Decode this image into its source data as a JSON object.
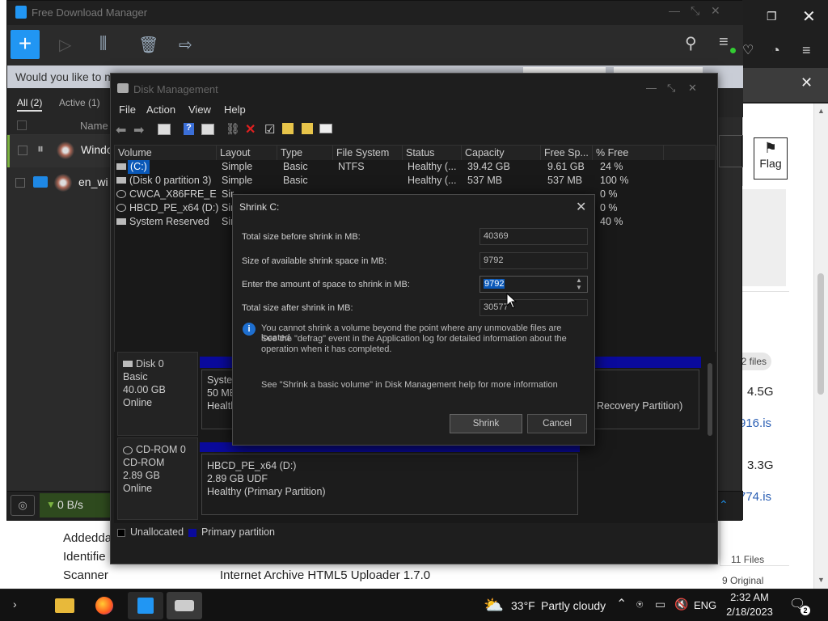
{
  "fdm": {
    "title": "Free Download Manager",
    "notice": "Would you like to ma",
    "notice_tail": "?",
    "tabs": [
      {
        "label": "All (2)"
      },
      {
        "label": "Active (1)"
      }
    ],
    "column_name": "Name",
    "rows": [
      {
        "name": "Windo"
      },
      {
        "name": "en_wi"
      }
    ],
    "speed": "0 B/s"
  },
  "browser": {
    "flag_label": "Flag",
    "files_badge": "2 files",
    "sizes": [
      "4.5G",
      "3.3G"
    ],
    "links": [
      "916.is",
      "774.is"
    ],
    "meta_labels": [
      "Addedda",
      "Identifie",
      "Scanner"
    ],
    "scanner_value": "Internet Archive HTML5 Uploader 1.7.0",
    "files_count": "11 Files",
    "original_count": "9 Original"
  },
  "disk_mgmt": {
    "title": "Disk Management",
    "menu": [
      "File",
      "Action",
      "View",
      "Help"
    ],
    "columns": [
      "Volume",
      "Layout",
      "Type",
      "File System",
      "Status",
      "Capacity",
      "Free Sp...",
      "% Free"
    ],
    "volumes": [
      {
        "volume": "(C:)",
        "layout": "Simple",
        "type": "Basic",
        "fs": "NTFS",
        "status": "Healthy (...",
        "capacity": "39.42 GB",
        "free": "9.61 GB",
        "pct": "24 %"
      },
      {
        "volume": "(Disk 0 partition 3)",
        "layout": "Simple",
        "type": "Basic",
        "fs": "",
        "status": "Healthy (...",
        "capacity": "537 MB",
        "free": "537 MB",
        "pct": "100 %"
      },
      {
        "volume": "CWCA_X86FRE_E...",
        "layout": "Sir",
        "type": "",
        "fs": "",
        "status": "",
        "capacity": "",
        "free": "",
        "pct": "0 %"
      },
      {
        "volume": "HBCD_PE_x64 (D:)",
        "layout": "Sir",
        "type": "",
        "fs": "",
        "status": "",
        "capacity": "",
        "free": "",
        "pct": "0 %"
      },
      {
        "volume": "System Reserved",
        "layout": "Sir",
        "type": "",
        "fs": "",
        "status": "",
        "capacity": "",
        "free": "",
        "pct": "40 %"
      }
    ],
    "disk0": {
      "name": "Disk 0",
      "type": "Basic",
      "size": "40.00 GB",
      "state": "Online",
      "part_name": "Syster",
      "part_size": "50 ME",
      "part_status": "Health",
      "recovery": "Recovery Partition)"
    },
    "cdrom0": {
      "name": "CD-ROM 0",
      "type": "CD-ROM",
      "size": "2.89 GB",
      "state": "Online",
      "part_name": "HBCD_PE_x64  (D:)",
      "part_size": "2.89 GB UDF",
      "part_status": "Healthy (Primary Partition)"
    },
    "legend": [
      {
        "label": "Unallocated",
        "color": "#000000"
      },
      {
        "label": "Primary partition",
        "color": "#0a0a9c"
      }
    ]
  },
  "shrink": {
    "title": "Shrink C:",
    "rows": [
      {
        "label": "Total size before shrink in MB:",
        "value": "40369"
      },
      {
        "label": "Size of available shrink space in MB:",
        "value": "9792"
      },
      {
        "label": "Enter the amount of space to shrink in MB:",
        "value": "9792"
      },
      {
        "label": "Total size after shrink in MB:",
        "value": "30577"
      }
    ],
    "info_1": "You cannot shrink a volume beyond the point where any unmovable files are located.",
    "info_2": "See the \"defrag\" event in the Application log for detailed information about the",
    "info_3": "operation when it has completed.",
    "help": "See \"Shrink a basic volume\" in Disk Management help for more information",
    "shrink_btn": "Shrink",
    "cancel_btn": "Cancel"
  },
  "taskbar": {
    "weather_temp": "33°F",
    "weather_desc": "Partly cloudy",
    "lang": "ENG",
    "time": "2:32 AM",
    "date": "2/18/2023"
  },
  "colors": {
    "accent": "#2196f3",
    "selection": "#0a58b8",
    "primary_partition": "#0a0a9c"
  }
}
